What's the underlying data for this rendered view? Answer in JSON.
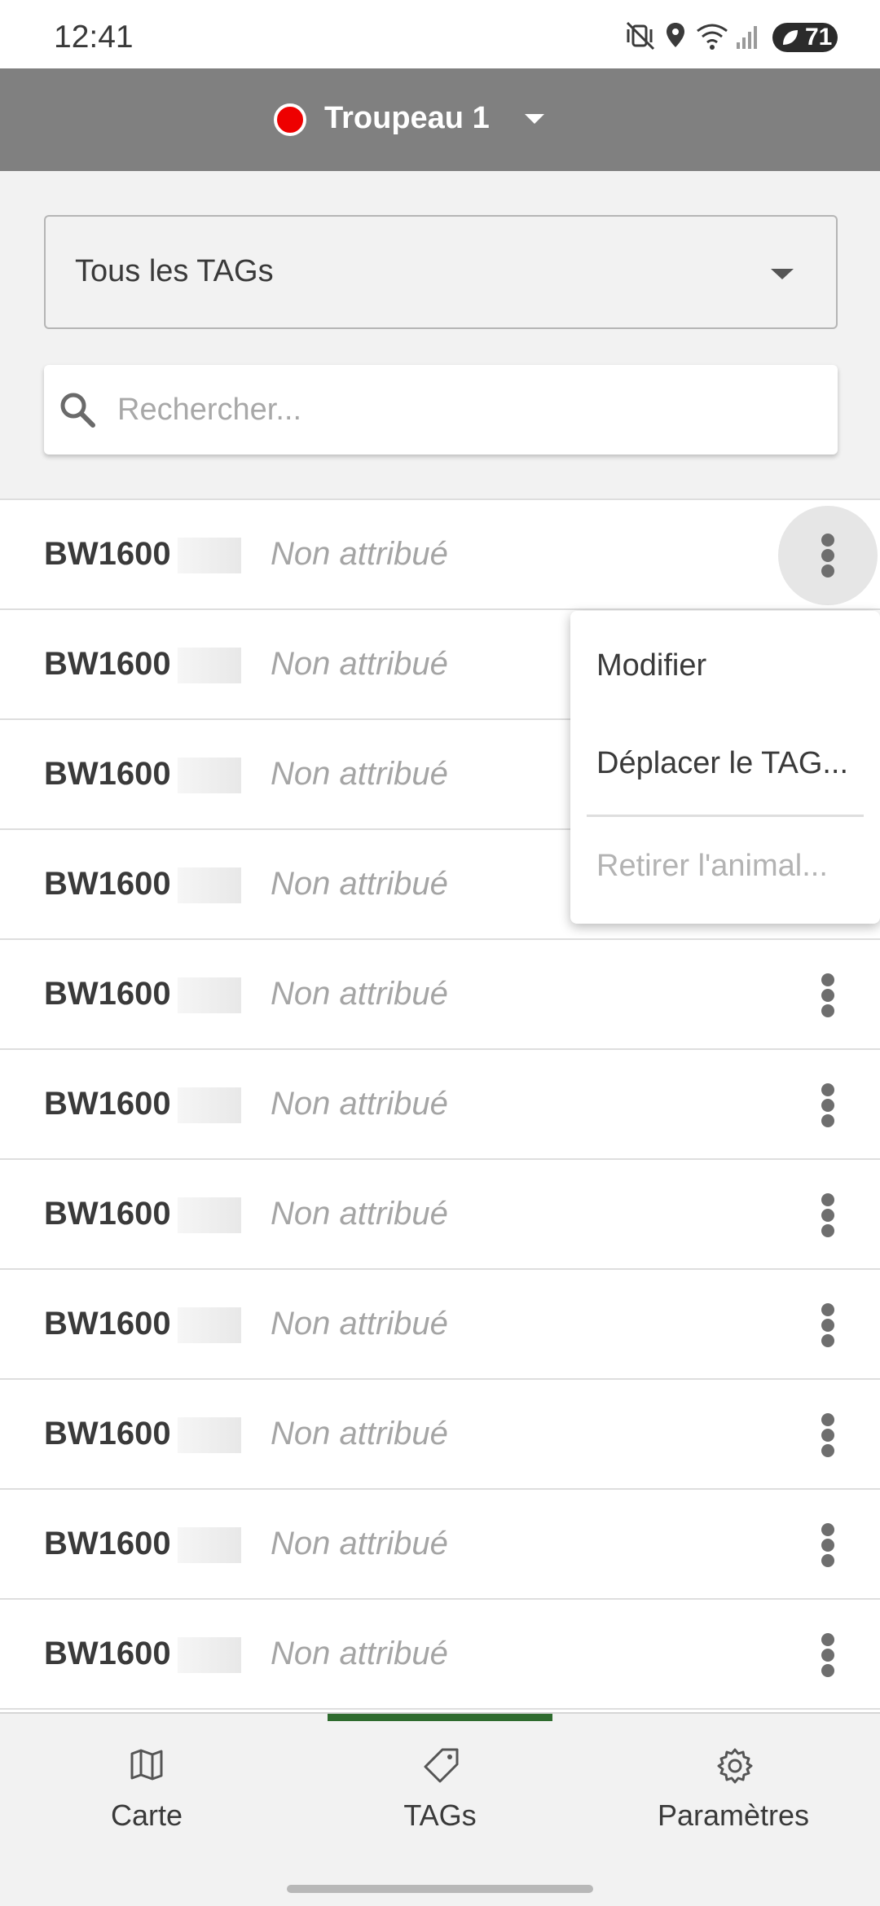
{
  "status_bar": {
    "time": "12:41",
    "battery": "71"
  },
  "header": {
    "herd_name": "Troupeau 1",
    "herd_color": "#ee0000"
  },
  "filter": {
    "selected": "Tous les TAGs"
  },
  "search": {
    "placeholder": "Rechercher..."
  },
  "tags": [
    {
      "id": "BW1600",
      "status": "Non attribué"
    },
    {
      "id": "BW1600",
      "status": "Non attribué"
    },
    {
      "id": "BW1600",
      "status": "Non attribué"
    },
    {
      "id": "BW1600",
      "status": "Non attribué"
    },
    {
      "id": "BW1600",
      "status": "Non attribué"
    },
    {
      "id": "BW1600",
      "status": "Non attribué"
    },
    {
      "id": "BW1600",
      "status": "Non attribué"
    },
    {
      "id": "BW1600",
      "status": "Non attribué"
    },
    {
      "id": "BW1600",
      "status": "Non attribué"
    },
    {
      "id": "BW1600",
      "status": "Non attribué"
    },
    {
      "id": "BW1600",
      "status": "Non attribué"
    }
  ],
  "context_menu": {
    "items": [
      {
        "label": "Modifier",
        "enabled": true
      },
      {
        "label": "Déplacer le TAG...",
        "enabled": true
      },
      {
        "label": "Retirer l'animal...",
        "enabled": false
      }
    ]
  },
  "bottom_nav": {
    "active_color": "#2e6b2e",
    "items": [
      {
        "label": "Carte",
        "icon": "map-icon"
      },
      {
        "label": "TAGs",
        "icon": "tag-icon",
        "active": true
      },
      {
        "label": "Paramètres",
        "icon": "gear-icon"
      }
    ]
  }
}
